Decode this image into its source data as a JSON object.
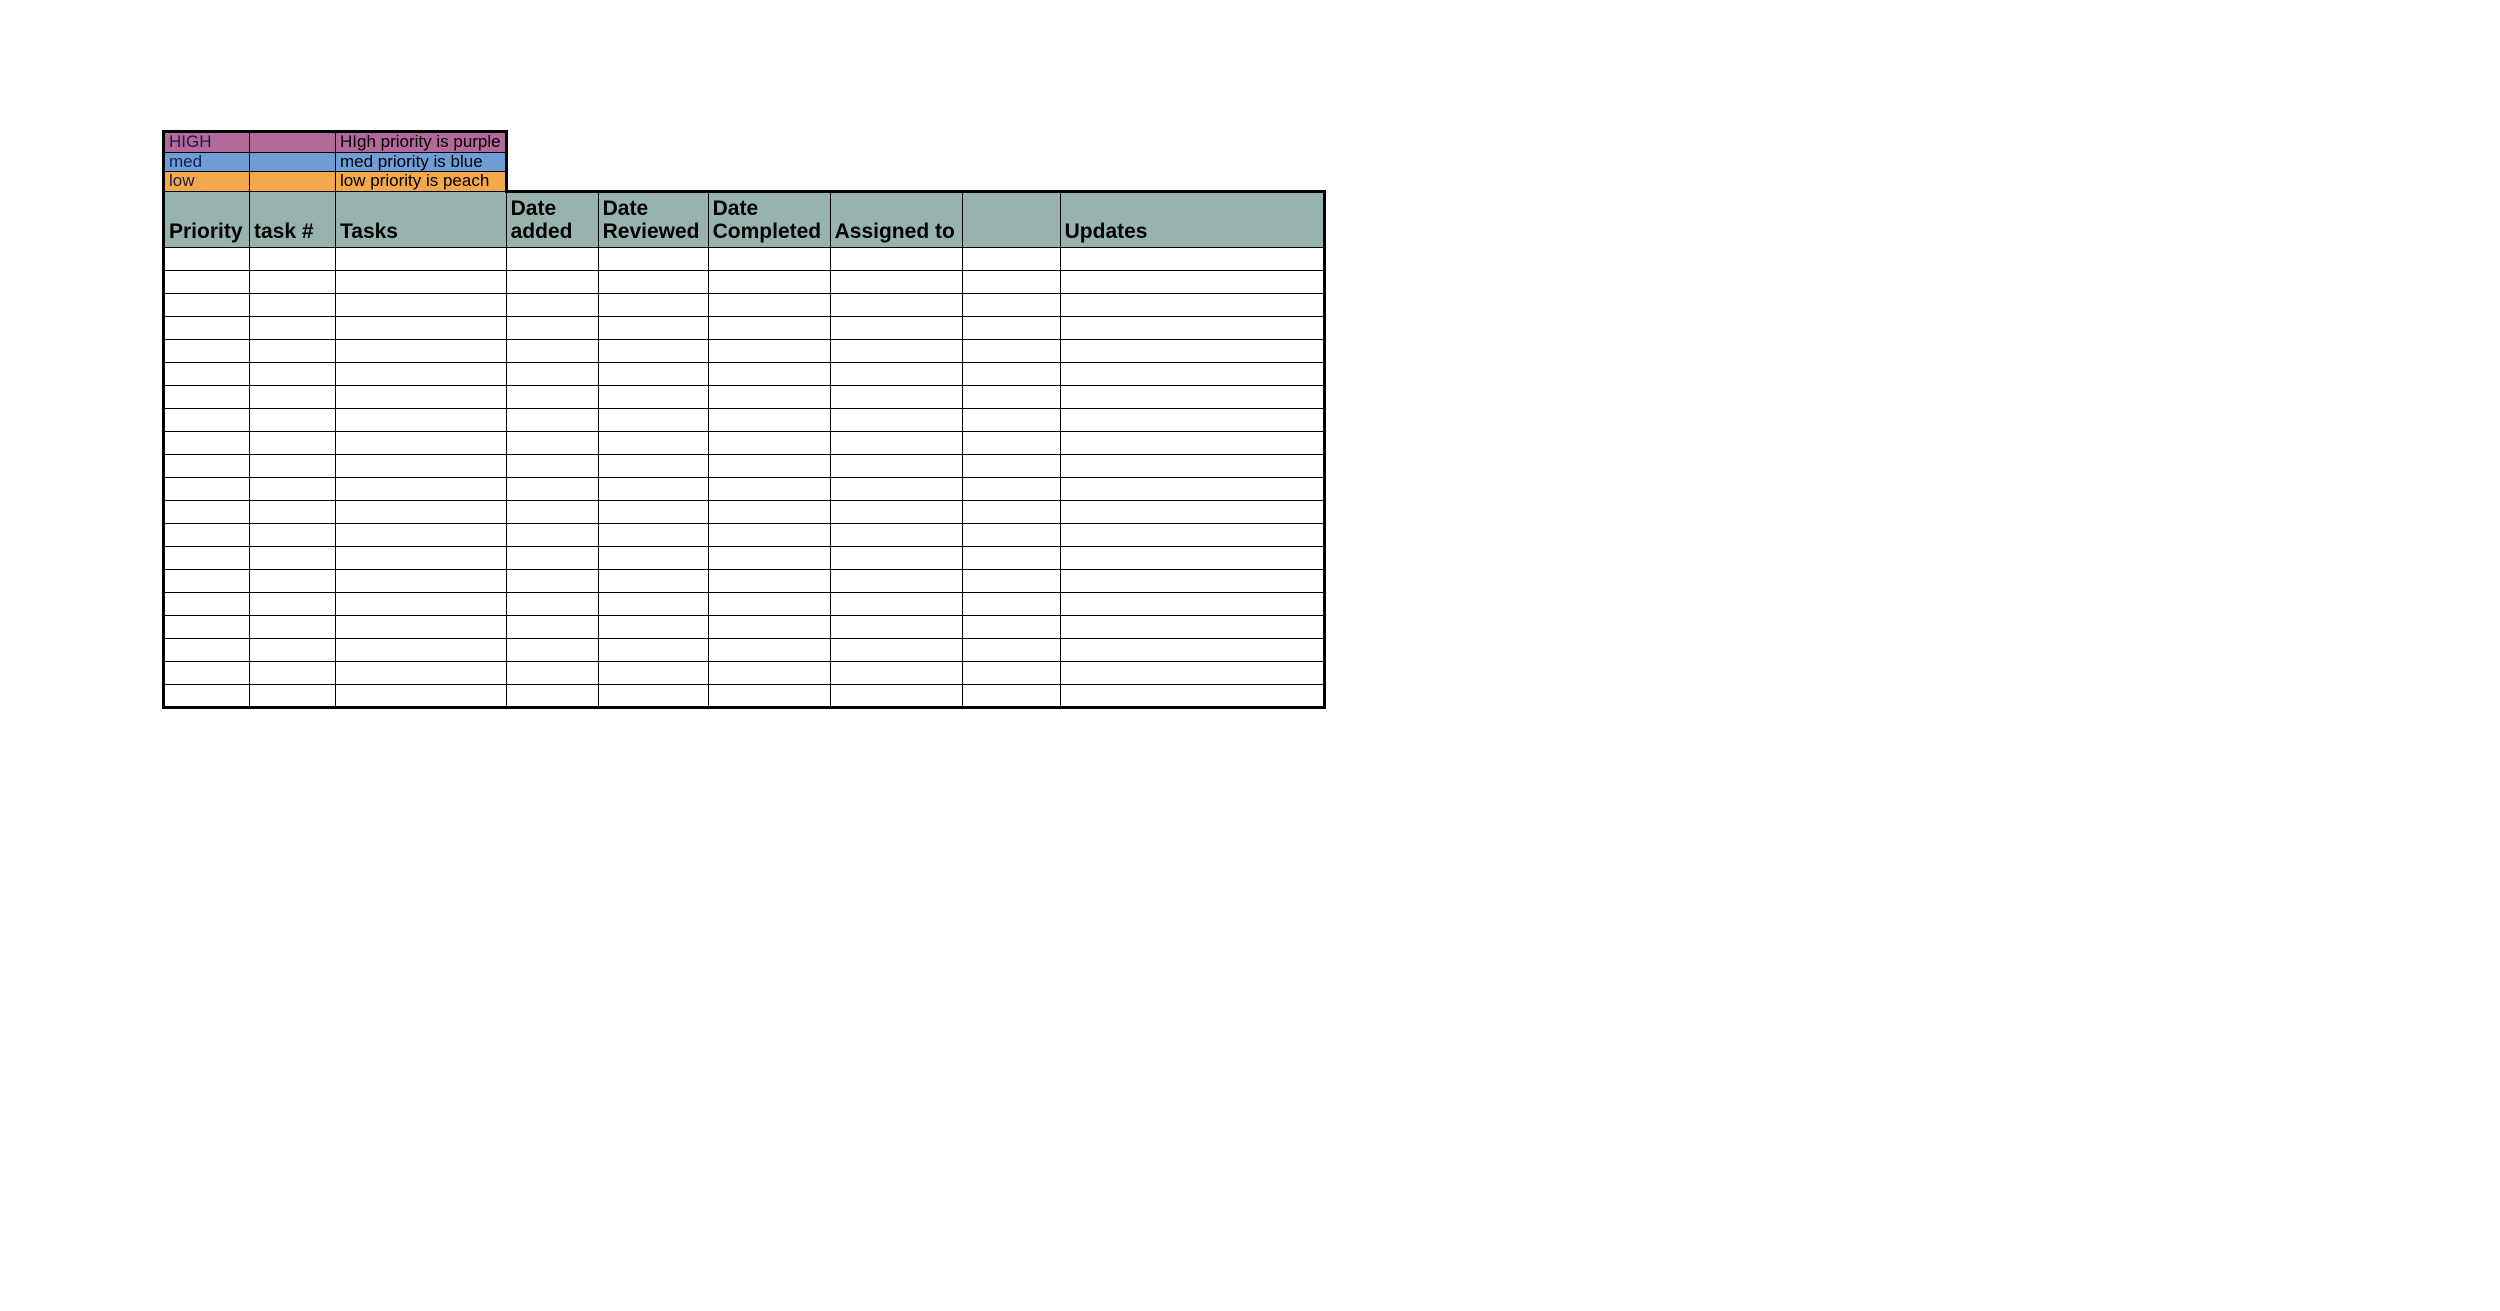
{
  "legend": [
    {
      "label": "HIGH",
      "desc": "HIgh priority is purple",
      "color": "#b26a9a"
    },
    {
      "label": "med",
      "desc": "med priority is blue",
      "color": "#6f9ed6"
    },
    {
      "label": "low",
      "desc": "low priority is peach",
      "color": "#f2a84b"
    }
  ],
  "headers": {
    "priority": "Priority",
    "task_num": "task #",
    "tasks": "Tasks",
    "date_added": "Date added",
    "date_reviewed": "Date Reviewed",
    "date_completed": "Date Completed",
    "assigned_to": "Assigned to",
    "updates": "Updates"
  },
  "row_count": 20
}
